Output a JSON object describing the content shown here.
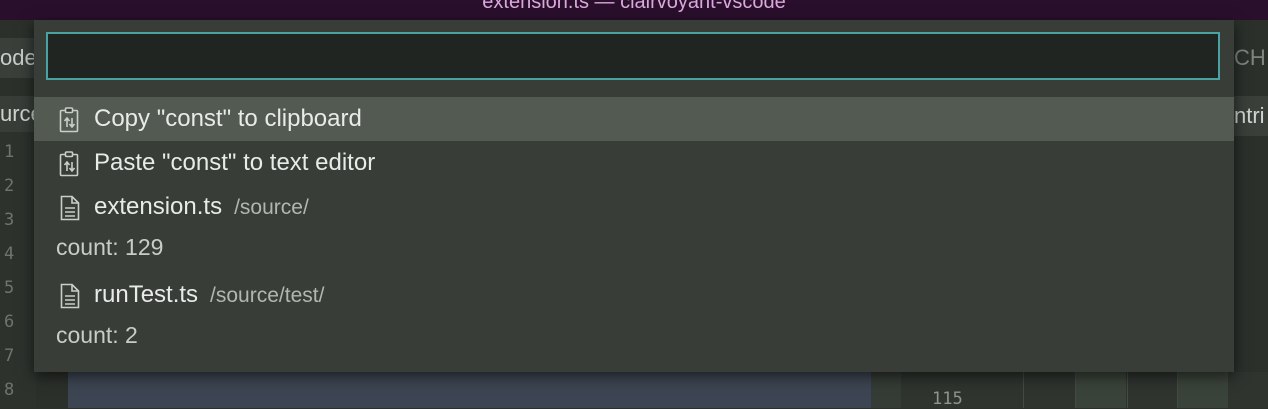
{
  "window": {
    "title": "extension.ts — clairvoyant-vscode"
  },
  "background": {
    "left_tab_label": "ode",
    "left_tab2_label": "urce",
    "right_tab_label": "CH",
    "right_tab2_label": "ntri",
    "line_numbers": [
      "1",
      "2",
      "3",
      "4",
      "5",
      "6",
      "7",
      "8"
    ],
    "right_line_number": "115"
  },
  "palette": {
    "search": {
      "value": "",
      "placeholder": ""
    },
    "items": [
      {
        "icon": "clipboard-icon",
        "label": "Copy \"const\" to clipboard"
      },
      {
        "icon": "clipboard-icon",
        "label": "Paste \"const\" to text editor"
      },
      {
        "icon": "file-icon",
        "label": "extension.ts",
        "description": "/source/",
        "detail": "count: 129"
      },
      {
        "icon": "file-icon",
        "label": "runTest.ts",
        "description": "/source/test/",
        "detail": "count: 2"
      }
    ]
  },
  "colors": {
    "titlebar": "#2a0f2c",
    "palette_bg": "#383d37",
    "selected_bg": "#525a52",
    "focus_border": "#4aa3a3"
  }
}
